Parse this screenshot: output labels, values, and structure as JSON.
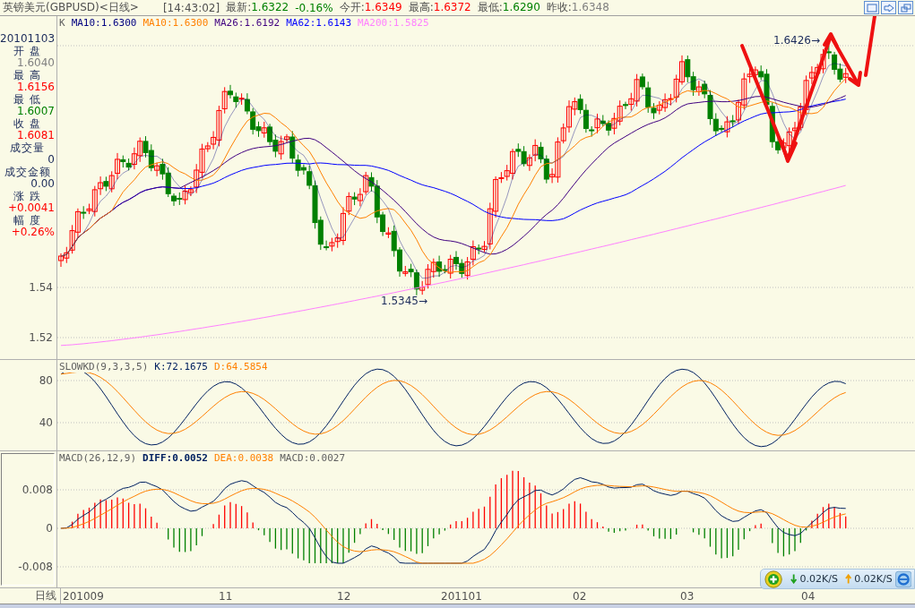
{
  "title_bar": {
    "symbol": "英镑美元(GBPUSD)<日线>",
    "time": "[14:43:02]",
    "quotes": [
      {
        "label": "最新:",
        "value": "1.6322",
        "color": "#008000"
      },
      {
        "value": "-0.16%",
        "color": "#008000"
      },
      {
        "label": "今开:",
        "value": "1.6349",
        "color": "#ff0000"
      },
      {
        "label": "最高:",
        "value": "1.6372",
        "color": "#ff0000"
      },
      {
        "label": "最低:",
        "value": "1.6290",
        "color": "#008000"
      },
      {
        "label": "昨收:",
        "value": "1.6348",
        "color": "#808080"
      }
    ]
  },
  "info_panel": {
    "date": "20101103",
    "fields": [
      {
        "label": "开 盘",
        "value": "1.6040",
        "color": "#808080"
      },
      {
        "label": "最 高",
        "value": "1.6156",
        "color": "#ff0000"
      },
      {
        "label": "最 低",
        "value": "1.6007",
        "color": "#008000"
      },
      {
        "label": "收 盘",
        "value": "1.6081",
        "color": "#ff0000"
      },
      {
        "label": "成交量",
        "value": "0",
        "color": "#1a2a5a"
      },
      {
        "label": "成交金额",
        "value": "0.00",
        "color": "#1a2a5a"
      },
      {
        "label": "涨 跌",
        "value": "+0.0041",
        "color": "#ff0000"
      },
      {
        "label": "幅 度",
        "value": "+0.26%",
        "color": "#ff0000"
      }
    ]
  },
  "price_chart": {
    "legend": [
      {
        "text": "K",
        "color": "#606060"
      },
      {
        "text": "MA10:1.6300",
        "color": "#000080"
      },
      {
        "text": "MA10:1.6300",
        "color": "#ff8000"
      },
      {
        "text": "MA26:1.6192",
        "color": "#400080"
      },
      {
        "text": "MA62:1.6143",
        "color": "#0000ff"
      },
      {
        "text": "MA200:1.5825",
        "color": "#ff80ff"
      }
    ],
    "axis_labels": [
      "1.54",
      "1.52"
    ],
    "annotations": [
      "1.6426→",
      "1.5345→"
    ]
  },
  "kd_chart": {
    "legend": [
      {
        "text": "SLOWKD(9,3,3,5)",
        "color": "#606060"
      },
      {
        "text": "K:72.1675",
        "color": "#002060"
      },
      {
        "text": "D:64.5854",
        "color": "#ff8000"
      }
    ],
    "axis_labels": [
      "80",
      "40"
    ]
  },
  "macd_chart": {
    "legend": [
      {
        "text": "MACD(26,12,9)",
        "color": "#606060"
      },
      {
        "text": "DIFF:0.0052",
        "color": "#002060"
      },
      {
        "text": "DEA:0.0038",
        "color": "#ff8000"
      },
      {
        "text": "MACD:0.0027",
        "color": "#606060"
      }
    ],
    "axis_labels": [
      "0.008",
      "0",
      "-0.008"
    ]
  },
  "time_axis": {
    "period": "日线",
    "labels": [
      "201009",
      "11",
      "12",
      "201101",
      "02",
      "03",
      "04"
    ]
  },
  "network_widget": {
    "download": "0.02K/S",
    "upload": "0.02K/S"
  }
}
